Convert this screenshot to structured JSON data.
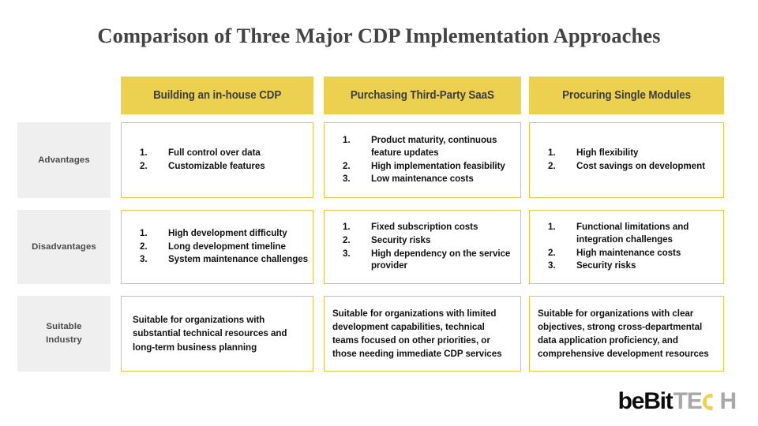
{
  "title": "Comparison of Three Major CDP Implementation Approaches",
  "columns": [
    {
      "id": "in-house",
      "label": "Building an in-house CDP"
    },
    {
      "id": "third-party-saas",
      "label": "Purchasing Third-Party SaaS"
    },
    {
      "id": "single-modules",
      "label": "Procuring Single Modules"
    }
  ],
  "rows": [
    {
      "id": "advantages",
      "label": "Advantages"
    },
    {
      "id": "disadvantages",
      "label": "Disadvantages"
    },
    {
      "id": "suitable-industry",
      "label": "Suitable\nIndustry"
    }
  ],
  "cells": {
    "advantages": {
      "in-house": {
        "type": "list",
        "items": [
          "Full control over data",
          "Customizable features"
        ]
      },
      "third-party-saas": {
        "type": "list",
        "items": [
          "Product maturity, continuous feature updates",
          "High implementation feasibility",
          "Low maintenance costs"
        ]
      },
      "single-modules": {
        "type": "list",
        "items": [
          "High flexibility",
          "Cost savings on development"
        ]
      }
    },
    "disadvantages": {
      "in-house": {
        "type": "list",
        "items": [
          "High development difficulty",
          "Long development timeline",
          "System maintenance challenges"
        ]
      },
      "third-party-saas": {
        "type": "list",
        "items": [
          "Fixed subscription costs",
          "Security risks",
          "High dependency on the service provider"
        ]
      },
      "single-modules": {
        "type": "list",
        "items": [
          "Functional limitations and integration challenges",
          "High maintenance costs",
          "Security risks"
        ]
      }
    },
    "suitable-industry": {
      "in-house": {
        "type": "text",
        "text": "Suitable for organizations with substantial technical resources and long-term business planning"
      },
      "third-party-saas": {
        "type": "text",
        "text": "Suitable for organizations with limited development capabilities, technical teams focused on other priorities, or those needing immediate CDP services"
      },
      "single-modules": {
        "type": "text",
        "text": "Suitable for organizations with clear objectives, strong cross-departmental data application proficiency, and comprehensive development resources"
      }
    }
  },
  "logo": {
    "part_brand": "beBit",
    "part_tech_te": "TE",
    "part_tech_c": "C",
    "part_tech_h": "H"
  },
  "colors": {
    "header_yellow": "#EBD14F",
    "cell_border": "#E4C444",
    "row_label_gray": "#EFEFEF",
    "title_text": "#434343",
    "body_text": "#111111",
    "logo_gray": "#A8A8A8"
  }
}
